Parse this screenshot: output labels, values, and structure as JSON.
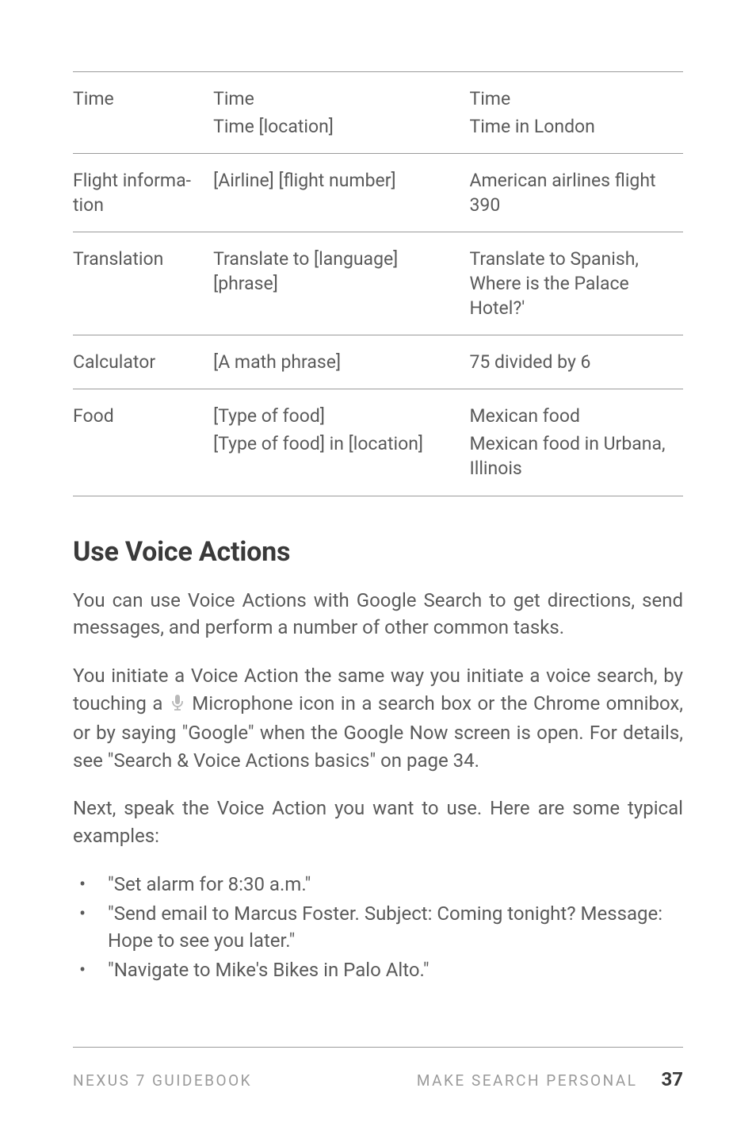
{
  "table": {
    "rows": [
      {
        "label": "Time",
        "say_a": "Time",
        "say_b": "Time [location]",
        "ex_a": "Time",
        "ex_b": "Time in London"
      },
      {
        "label": "Flight informa­tion",
        "say_a": "[Airline] [flight number]",
        "ex_a": "American airlines flight 390"
      },
      {
        "label": "Translation",
        "say_a": "Translate to [language] [phrase]",
        "ex_a": "Translate to Spanish, Where is the Palace Hotel?'"
      },
      {
        "label": "Calculator",
        "say_a": "[A math phrase]",
        "ex_a": "75 divided by 6"
      },
      {
        "label": "Food",
        "say_a": "[Type of food]",
        "say_b": "[Type of food] in [location]",
        "ex_a": "Mexican food",
        "ex_b": "Mexican food in Urbana, Illinois"
      }
    ]
  },
  "heading": "Use Voice Actions",
  "para1": "You can use Voice Actions with Google Search to get directions, send messages, and perform a number of other common tasks.",
  "para2_a": "You initiate a Voice Action the same way you initiate a voice search, by touching a ",
  "para2_b": " Microphone icon in a search box or the Chrome omnibox, or by saying \"Google\" when the Google Now screen is open. For details, see \"Search & Voice Actions basics\" on page 34.",
  "para3": "Next, speak the Voice Action you want to use. Here are some typi­cal examples:",
  "examples": [
    "\"Set alarm for 8:30 a.m.\"",
    "\"Send email to Marcus Foster. Subject: Coming tonight? Mes­sage: Hope to see you later.\"",
    "\"Navigate to Mike's Bikes in Palo Alto.\""
  ],
  "footer": {
    "left": "NEXUS 7 GUIDEBOOK",
    "right": "MAKE SEARCH PERSONAL",
    "page": "37"
  }
}
